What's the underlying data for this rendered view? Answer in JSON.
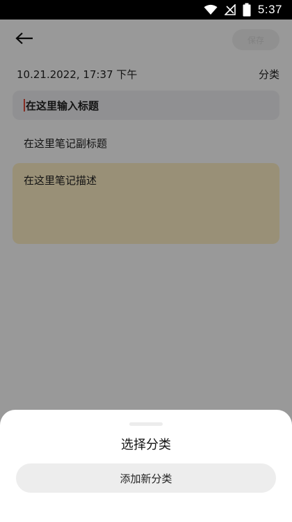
{
  "status_bar": {
    "time": "5:37",
    "battery_level": "5"
  },
  "header": {
    "save_label": "保存"
  },
  "note": {
    "datetime": "10.21.2022, 17:37 下午",
    "category_label": "分类",
    "title_placeholder": "在这里输入标题",
    "subtitle_placeholder": "在这里笔记副标题",
    "description_placeholder": "在这里笔记描述",
    "description_bg": "#fff0c6"
  },
  "sheet": {
    "title": "选择分类",
    "add_button_label": "添加新分类"
  }
}
